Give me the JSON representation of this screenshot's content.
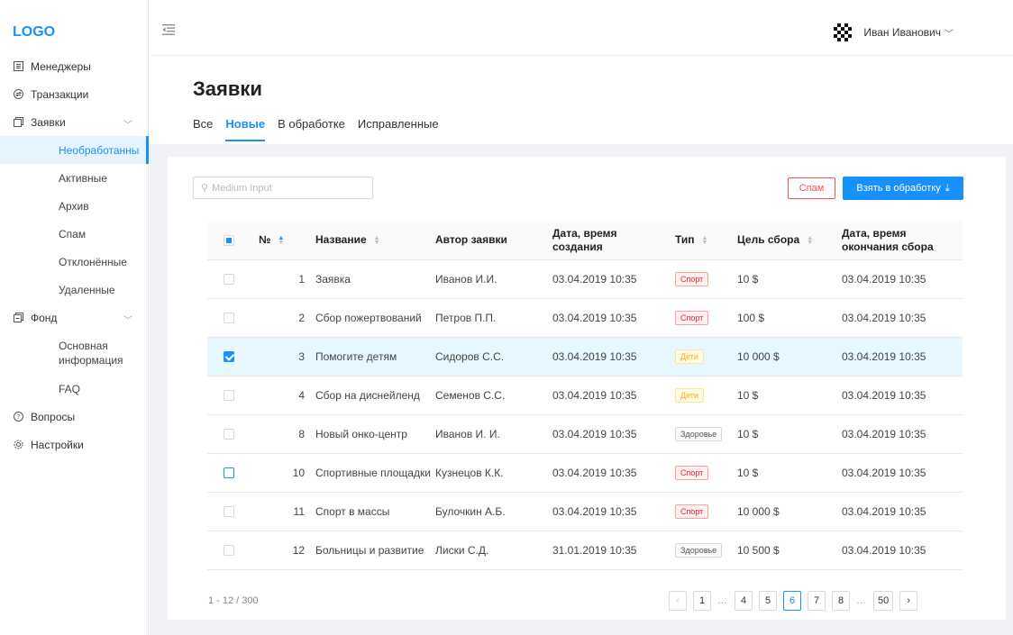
{
  "logo": "LOGO",
  "user": {
    "name": "Иван Иванович"
  },
  "sidebar": {
    "items": [
      {
        "label": "Менеджеры",
        "icon": "list-icon"
      },
      {
        "label": "Транзакции",
        "icon": "transactions-icon"
      },
      {
        "label": "Заявки",
        "icon": "requests-icon",
        "expanded": true,
        "children": [
          "Необработанны",
          "Активные",
          "Архив",
          "Спам",
          "Отклонённые",
          "Удаленные"
        ],
        "active_child": 0
      },
      {
        "label": "Фонд",
        "icon": "fund-icon",
        "expanded": true,
        "children": [
          "Основная информация",
          "FAQ"
        ]
      },
      {
        "label": "Вопросы",
        "icon": "question-icon"
      },
      {
        "label": "Настройки",
        "icon": "settings-icon"
      }
    ]
  },
  "page": {
    "title": "Заявки",
    "tabs": [
      {
        "label": "Все",
        "active": false
      },
      {
        "label": "Новые",
        "active": true
      },
      {
        "label": "В обработке",
        "active": false
      },
      {
        "label": "Исправленные",
        "active": false
      }
    ]
  },
  "toolbar": {
    "search_placeholder": "Medium Input",
    "spam_label": "Спам",
    "take_label": "Взять в обработку"
  },
  "table": {
    "columns": {
      "num": "№",
      "name": "Название",
      "author": "Автор заявки",
      "created": "Дата, время создания",
      "type": "Тип",
      "goal": "Цель сбора",
      "end": "Дата, время окончания сбора"
    },
    "rows": [
      {
        "num": "1",
        "name": "Заявка",
        "author": "Иванов И.И.",
        "created": "03.04.2019 10:35",
        "type": "Спорт",
        "type_kind": "sport",
        "goal": "10 $",
        "end": "03.04.2019 10:35",
        "checked": false,
        "selected": false,
        "focus": false
      },
      {
        "num": "2",
        "name": "Сбор пожертвований",
        "author": "Петров П.П.",
        "created": "03.04.2019 10:35",
        "type": "Спорт",
        "type_kind": "sport",
        "goal": "100 $",
        "end": "03.04.2019 10:35",
        "checked": false,
        "selected": false,
        "focus": false
      },
      {
        "num": "3",
        "name": "Помогите детям",
        "author": "Сидоров С.С.",
        "created": "03.04.2019 10:35",
        "type": "Дети",
        "type_kind": "kids",
        "goal": "10 000 $",
        "end": "03.04.2019 10:35",
        "checked": true,
        "selected": true,
        "focus": false
      },
      {
        "num": "4",
        "name": "Сбор на диснейленд",
        "author": "Семенов С.С.",
        "created": "03.04.2019 10:35",
        "type": "Дети",
        "type_kind": "kids",
        "goal": "10 $",
        "end": "03.04.2019 10:35",
        "checked": false,
        "selected": false,
        "focus": false
      },
      {
        "num": "8",
        "name": "Новый онко-центр",
        "author": "Иванов И. И.",
        "created": "03.04.2019 10:35",
        "type": "Здоровье",
        "type_kind": "health",
        "goal": "10 $",
        "end": "03.04.2019 10:35",
        "checked": false,
        "selected": false,
        "focus": false
      },
      {
        "num": "10",
        "name": "Спортивные площадки",
        "author": "Кузнецов К.К.",
        "created": "03.04.2019 10:35",
        "type": "Спорт",
        "type_kind": "sport",
        "goal": "10 $",
        "end": "03.04.2019 10:35",
        "checked": false,
        "selected": false,
        "focus": true
      },
      {
        "num": "11",
        "name": "Спорт в массы",
        "author": "Булочкин А.Б.",
        "created": "03.04.2019 10:35",
        "type": "Спорт",
        "type_kind": "sport",
        "goal": "10 000 $",
        "end": "03.04.2019 10:35",
        "checked": false,
        "selected": false,
        "focus": false
      },
      {
        "num": "12",
        "name": "Больницы и развитие",
        "author": "Лиски С.Д.",
        "created": "31.01.2019 10:35",
        "type": "Здоровье",
        "type_kind": "health",
        "goal": "10 500 $",
        "end": "03.04.2019 10:35",
        "checked": false,
        "selected": false,
        "focus": false
      }
    ]
  },
  "footer": {
    "count": "1 - 12 / 300",
    "pages": [
      "‹",
      "1",
      "…",
      "4",
      "5",
      "6",
      "7",
      "8",
      "…",
      "50",
      "›"
    ],
    "active_page": "6"
  },
  "colors": {
    "accent": "#1890ff",
    "danger": "#ff4d4f"
  }
}
